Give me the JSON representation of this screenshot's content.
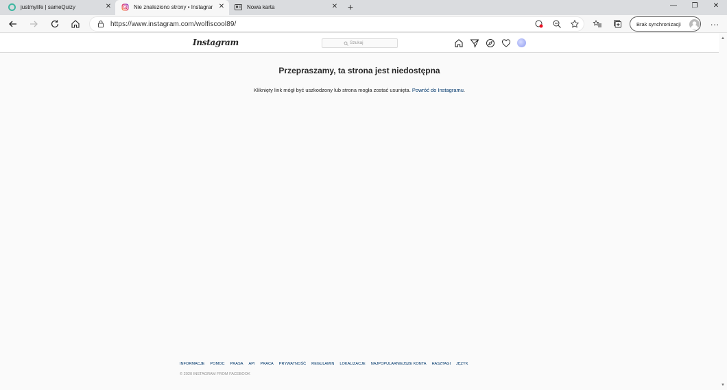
{
  "browser": {
    "tabs": [
      {
        "title": "justmylife | sameQuizy",
        "active": false
      },
      {
        "title": "Nie znaleziono strony • Instagram",
        "active": true
      },
      {
        "title": "Nowa karta",
        "active": false
      }
    ],
    "address": {
      "url": "https://www.instagram.com/wolfiscool89/"
    },
    "sync_label": "Brak synchronizacji",
    "icons": [
      "back-icon",
      "forward-icon",
      "refresh-icon",
      "home-icon",
      "lock-icon",
      "tracking-prevention-icon",
      "zoom-out-icon",
      "favorite-star-icon",
      "favorites-list-icon",
      "collections-icon",
      "more-icon"
    ]
  },
  "instagram": {
    "logo": "Instagram",
    "search_placeholder": "Szukaj",
    "nav_icons": [
      "home-icon",
      "direct-icon",
      "explore-icon",
      "activity-heart-icon",
      "profile-avatar"
    ]
  },
  "main": {
    "title": "Przepraszamy, ta strona jest niedostępna",
    "message": "Kliknięty link mógł być uszkodzony lub strona mogła zostać usunięta.",
    "link": "Powróć do Instagramu",
    "link_suffix": "."
  },
  "footer": {
    "links": [
      "Informacje",
      "Pomoc",
      "Prasa",
      "API",
      "Praca",
      "Prywatność",
      "Regulamin",
      "Lokalizacje",
      "Najpopularniejsze konta",
      "Hasztagi",
      "Język"
    ],
    "copyright": "© 2020 Instagram from Facebook"
  }
}
